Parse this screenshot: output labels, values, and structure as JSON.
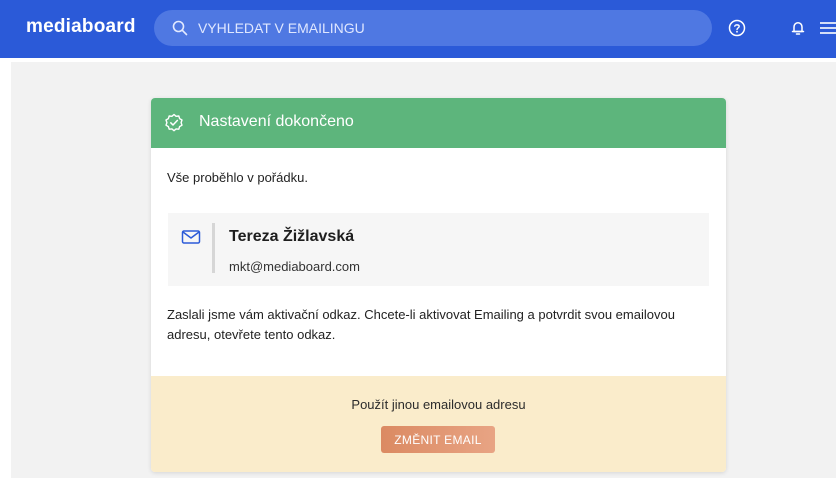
{
  "header": {
    "logo": "mediaboard",
    "search": {
      "placeholder": "VYHLEDAT V EMAILINGU",
      "icon": "search-icon"
    },
    "icons": [
      "help-icon",
      "bell-icon",
      "menu-icon"
    ]
  },
  "card": {
    "title": "Nastavení dokončeno",
    "intro": "Vše proběhlo v pořádku.",
    "contact": {
      "name": "Tereza Žižlavská",
      "email": "mkt@mediaboard.com"
    },
    "message": "Zaslali jsme vám aktivační odkaz. Chcete-li aktivovat Emailing a potvrdit svou emailovou adresu, otevřete tento odkaz.",
    "footer": {
      "label": "Použít jinou emailovou adresu",
      "button": "ZMĚNIT EMAIL"
    }
  },
  "colors": {
    "topbar": "#2b5ad8",
    "header_success": "#5db57c",
    "footer_bg": "#faeccb",
    "button": "#e09070"
  }
}
